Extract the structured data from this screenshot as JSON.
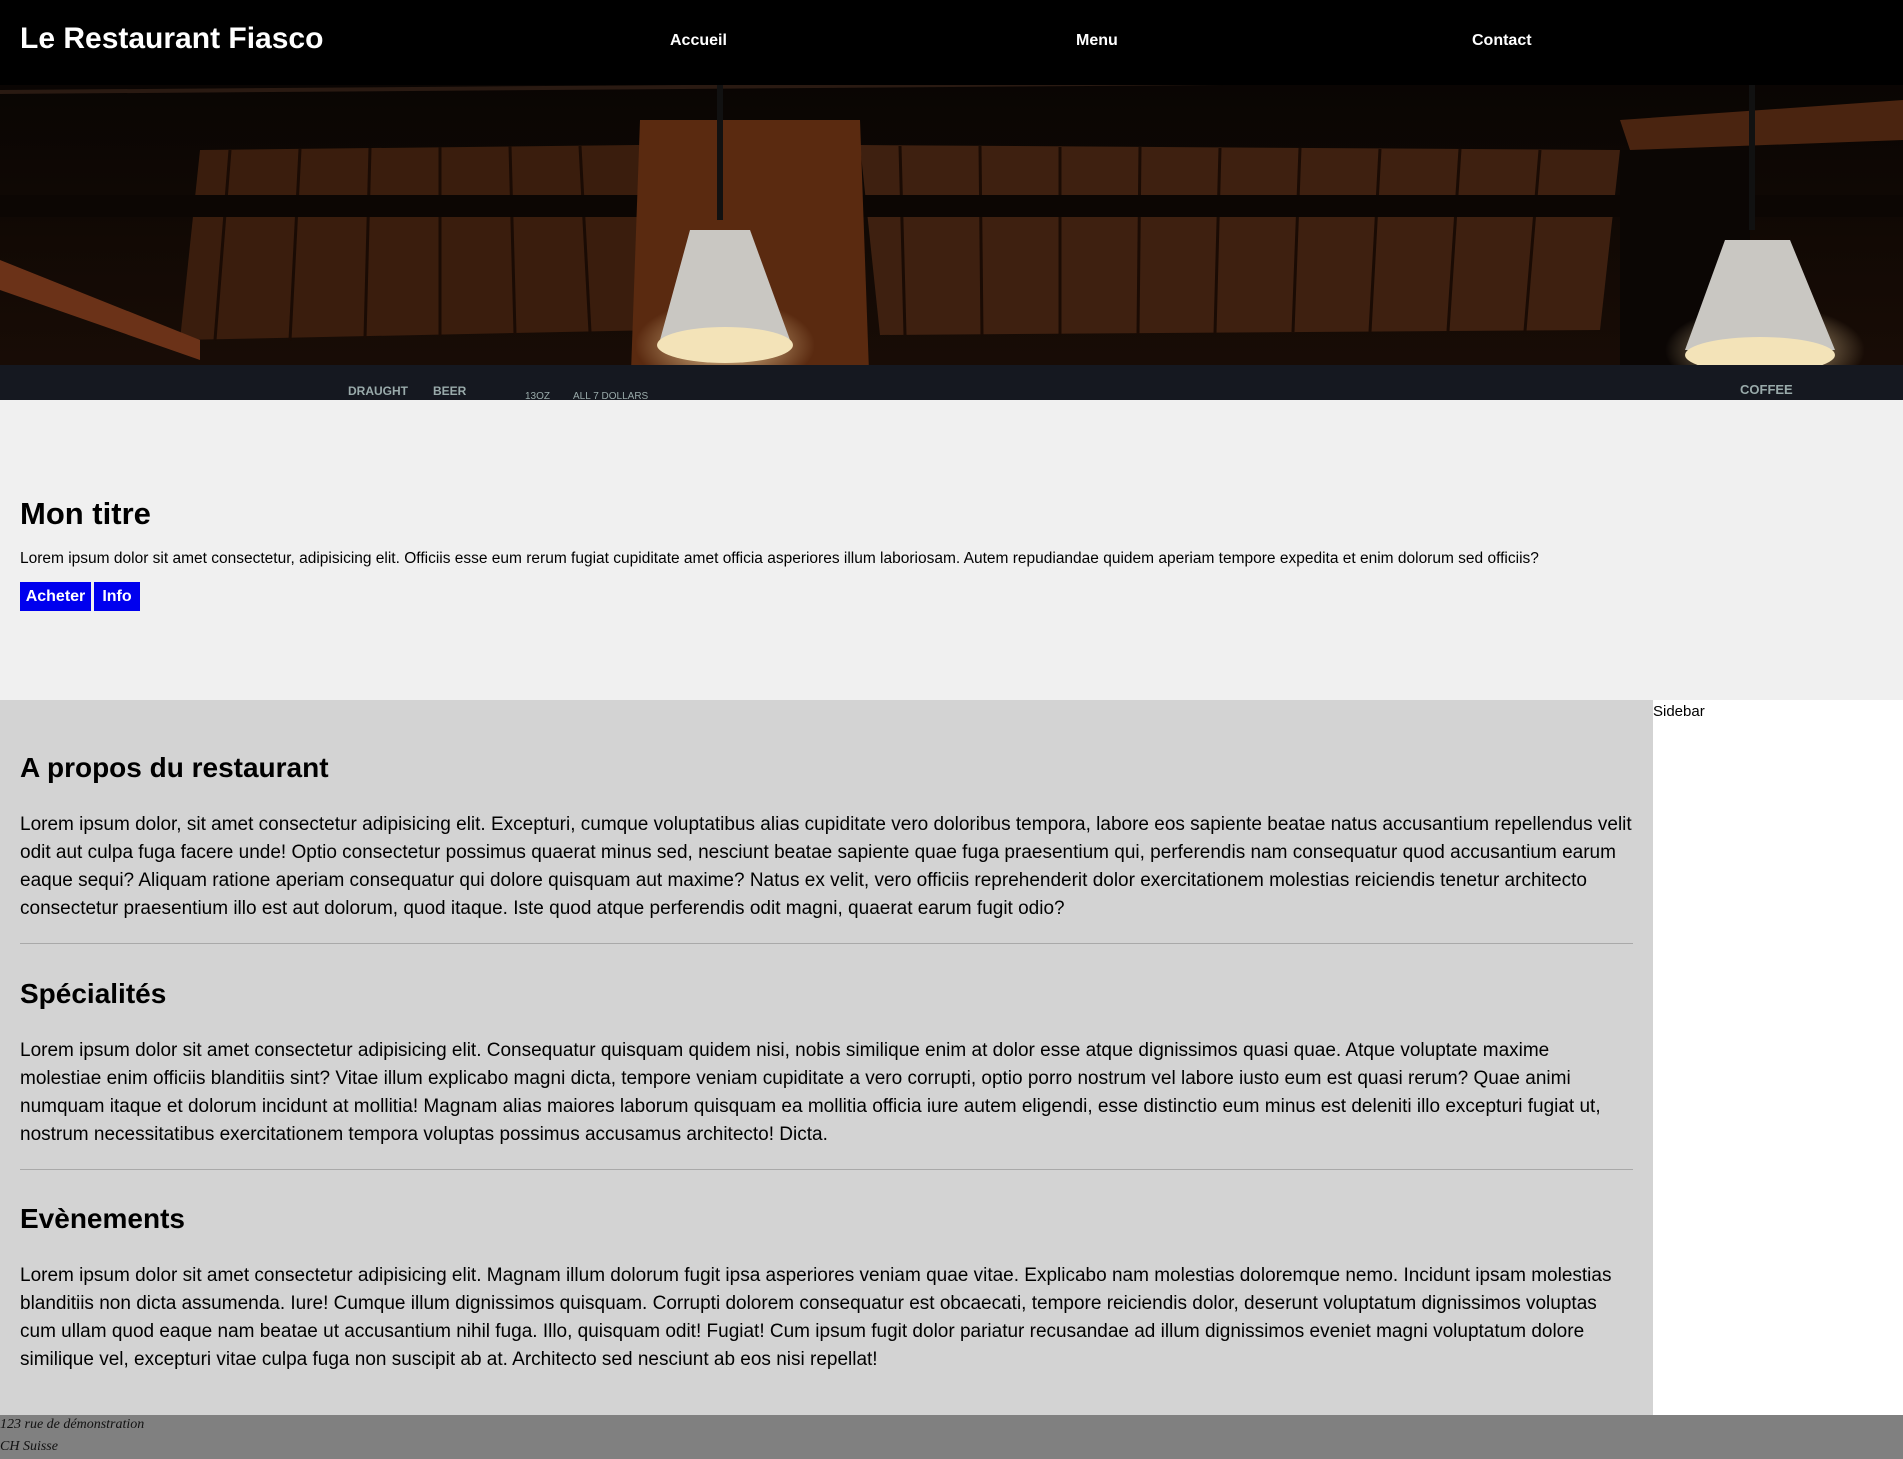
{
  "header": {
    "brand": "Le Restaurant Fiasco",
    "nav": {
      "home": "Accueil",
      "menu": "Menu",
      "contact": "Contact"
    },
    "hero_signs": [
      "DRAUGHT",
      "BEER",
      "13OZ",
      "ALL 7 DOLLARS",
      "COFFEE"
    ]
  },
  "intro": {
    "title": "Mon titre",
    "text": "Lorem ipsum dolor sit amet consectetur, adipisicing elit. Officiis esse eum rerum fugiat cupiditate amet officia asperiores illum laboriosam. Autem repudiandae quidem aperiam tempore expedita et enim dolorum sed officiis?",
    "buy_label": "Acheter",
    "info_label": "Info"
  },
  "sections": [
    {
      "title": "A propos du restaurant",
      "text": "Lorem ipsum dolor, sit amet consectetur adipisicing elit. Excepturi, cumque voluptatibus alias cupiditate vero doloribus tempora, labore eos sapiente beatae natus accusantium repellendus velit odit aut culpa fuga facere unde! Optio consectetur possimus quaerat minus sed, nesciunt beatae sapiente quae fuga praesentium qui, perferendis nam consequatur quod accusantium earum eaque sequi? Aliquam ratione aperiam consequatur qui dolore quisquam aut maxime? Natus ex velit, vero officiis reprehenderit dolor exercitationem molestias reiciendis tenetur architecto consectetur praesentium illo est aut dolorum, quod itaque. Iste quod atque perferendis odit magni, quaerat earum fugit odio?"
    },
    {
      "title": "Spécialités",
      "text": "Lorem ipsum dolor sit amet consectetur adipisicing elit. Consequatur quisquam quidem nisi, nobis similique enim at dolor esse atque dignissimos quasi quae. Atque voluptate maxime molestiae enim officiis blanditiis sint? Vitae illum explicabo magni dicta, tempore veniam cupiditate a vero corrupti, optio porro nostrum vel labore iusto eum est quasi rerum? Quae animi numquam itaque et dolorum incidunt at mollitia! Magnam alias maiores laborum quisquam ea mollitia officia iure autem eligendi, esse distinctio eum minus est deleniti illo excepturi fugiat ut, nostrum necessitatibus exercitationem tempora voluptas possimus accusamus architecto! Dicta."
    },
    {
      "title": "Evènements",
      "text": "Lorem ipsum dolor sit amet consectetur adipisicing elit. Magnam illum dolorum fugit ipsa asperiores veniam quae vitae. Explicabo nam molestias doloremque nemo. Incidunt ipsam molestias blanditiis non dicta assumenda. Iure! Cumque illum dignissimos quisquam. Corrupti dolorem consequatur est obcaecati, tempore reiciendis dolor, deserunt voluptatum dignissimos voluptas cum ullam quod eaque nam beatae ut accusantium nihil fuga. Illo, quisquam odit! Fugiat! Cum ipsum fugit dolor pariatur recusandae ad illum dignissimos eveniet magni voluptatum dolore similique vel, excepturi vitae culpa fuga non suscipit ab at. Architecto sed nesciunt ab eos nisi repellat!"
    }
  ],
  "sidebar": {
    "label": "Sidebar"
  },
  "footer": {
    "address_line1": "123 rue de démonstration",
    "address_line2": "CH Suisse"
  },
  "colors": {
    "topbar": "#000000",
    "button": "#0000ee",
    "intro_bg": "#f0f0f0",
    "main_bg": "#d3d3d3",
    "footer_bg": "#808080"
  }
}
